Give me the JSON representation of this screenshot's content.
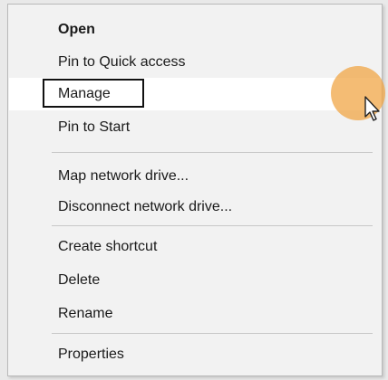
{
  "context_menu": {
    "items": [
      {
        "label": "Open"
      },
      {
        "label": "Pin to Quick access"
      },
      {
        "label": "Manage"
      },
      {
        "label": "Pin to Start"
      },
      {
        "label": "Map network drive..."
      },
      {
        "label": "Disconnect network drive..."
      },
      {
        "label": "Create shortcut"
      },
      {
        "label": "Delete"
      },
      {
        "label": "Rename"
      },
      {
        "label": "Properties"
      }
    ],
    "hovered_item": "Manage",
    "default_item": "Open"
  },
  "colors": {
    "menu_background": "#f2f2f2",
    "hover_background": "#ffffff",
    "separator": "#c8c8c8",
    "click_indicator": "#f0a546"
  },
  "icons": {
    "cursor": "mouse-pointer-icon"
  }
}
